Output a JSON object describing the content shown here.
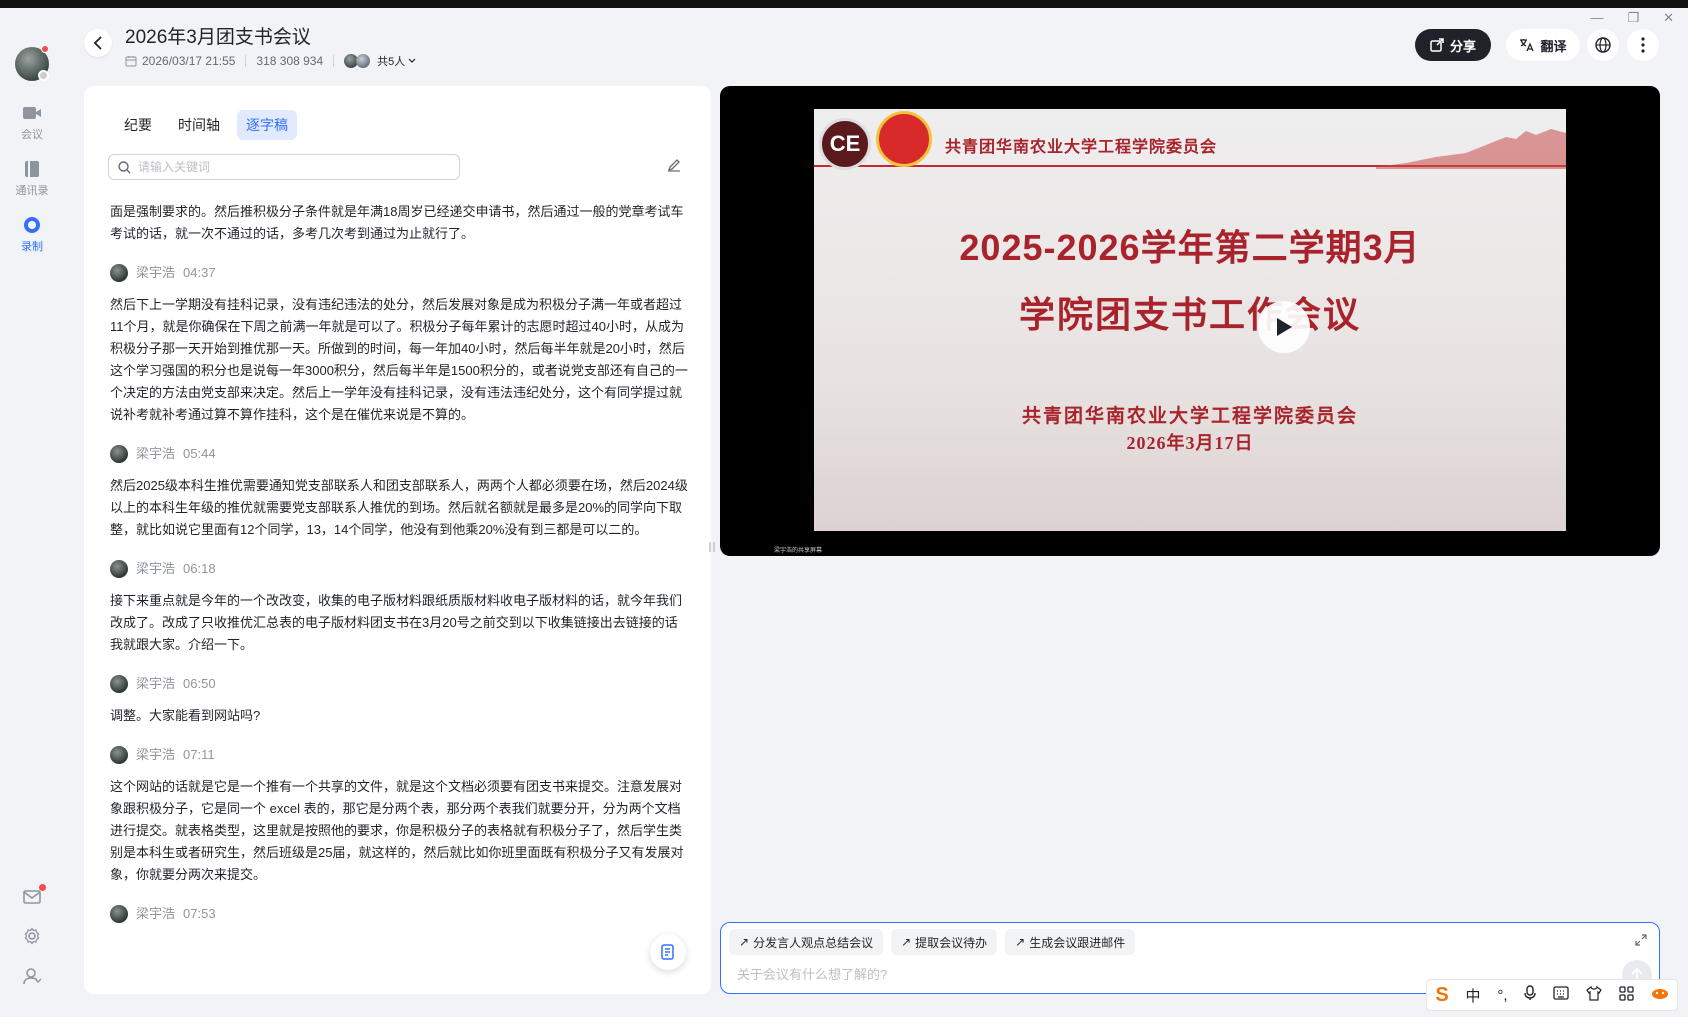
{
  "window": {
    "min": "—",
    "restore": "❐",
    "close": "✕"
  },
  "sidebar": {
    "items": [
      {
        "label": "会议",
        "icon": "video-icon"
      },
      {
        "label": "通讯录",
        "icon": "contacts-icon"
      },
      {
        "label": "录制",
        "icon": "record-icon"
      }
    ],
    "active": "录制"
  },
  "header": {
    "title": "2026年3月团支书会议",
    "datetime": "2026/03/17 21:55",
    "meeting_id": "318 308 934",
    "participants": "共5人",
    "share_label": "分享",
    "translate_label": "翻译"
  },
  "left": {
    "tabs": [
      {
        "label": "纪要"
      },
      {
        "label": "时间轴"
      },
      {
        "label": "逐字稿"
      }
    ],
    "active_tab": "逐字稿",
    "search_placeholder": "请输入关键词",
    "transcript": {
      "intro": "面是强制要求的。然后推积极分子条件就是年满18周岁已经递交申请书，然后通过一般的党章考试车考试的话，就一次不通过的话，多考几次考到通过为止就行了。",
      "segments": [
        {
          "speaker": "梁宇浩",
          "time": "04:37",
          "text": "然后下上一学期没有挂科记录，没有违纪违法的处分，然后发展对象是成为积极分子满一年或者超过11个月，就是你确保在下周之前满一年就是可以了。积极分子每年累计的志愿时超过40小时，从成为积极分子那一天开始到推优那一天。所做到的时间，每一年加40小时，然后每半年就是20小时，然后这个学习强国的积分也是说每一年3000积分，然后每半年是1500积分的，或者说党支部还有自己的一个决定的方法由党支部来决定。然后上一学年没有挂科记录，没有违法违纪处分，这个有同学提过就说补考就补考通过算不算作挂科，这个是在催优来说是不算的。"
        },
        {
          "speaker": "梁宇浩",
          "time": "05:44",
          "text": "然后2025级本科生推优需要通知党支部联系人和团支部联系人，两两个人都必须要在场，然后2024级以上的本科生年级的推优就需要党支部联系人推优的到场。然后就名额就是最多是20%的同学向下取整，就比如说它里面有12个同学，13，14个同学，他没有到他乘20%没有到三都是可以二的。"
        },
        {
          "speaker": "梁宇浩",
          "time": "06:18",
          "text": "接下来重点就是今年的一个改改变，收集的电子版材料跟纸质版材料收电子版材料的话，就今年我们改成了。改成了只收推优汇总表的电子版材料团支书在3月20号之前交到以下收集链接出去链接的话我就跟大家。介绍一下。"
        },
        {
          "speaker": "梁宇浩",
          "time": "06:50",
          "text": "调整。大家能看到网站吗?"
        },
        {
          "speaker": "梁宇浩",
          "time": "07:11",
          "text": "这个网站的话就是它是一个推有一个共享的文件，就是这个文档必须要有团支书来提交。注意发展对象跟积极分子，它是同一个 excel 表的，那它是分两个表，那分两个表我们就要分开，分为两个文档进行提交。就表格类型，这里就是按照他的要求，你是积极分子的表格就有积极分子了，然后学生类别是本科生或者研究生，然后班级是25届，就这样的，然后就比如你班里面既有积极分子又有发展对象，你就要分两次来提交。"
        },
        {
          "speaker": "梁宇浩",
          "time": "07:53",
          "text": ""
        }
      ]
    }
  },
  "video": {
    "slide_org": "共青团华南农业大学工程学院委员会",
    "slide_title_1": "2025-2026学年第二学期3月",
    "slide_title_2": "学院团支书工作会议",
    "slide_sub": "共青团华南农业大学工程学院委员会",
    "slide_date": "2026年3月17日",
    "caption": "梁宇浩的共享屏幕",
    "logo_text": "CE"
  },
  "assistant": {
    "chips": [
      {
        "label": "分发言人观点总结会议"
      },
      {
        "label": "提取会议待办"
      },
      {
        "label": "生成会议跟进邮件"
      }
    ],
    "placeholder": "关于会议有什么想了解的?"
  },
  "ime": {
    "logo": "S",
    "mode": "中",
    "punct": "°,"
  },
  "colors": {
    "accent": "#3370ff",
    "slide_red": "#a8232b",
    "dark_btn": "#1f2329"
  }
}
